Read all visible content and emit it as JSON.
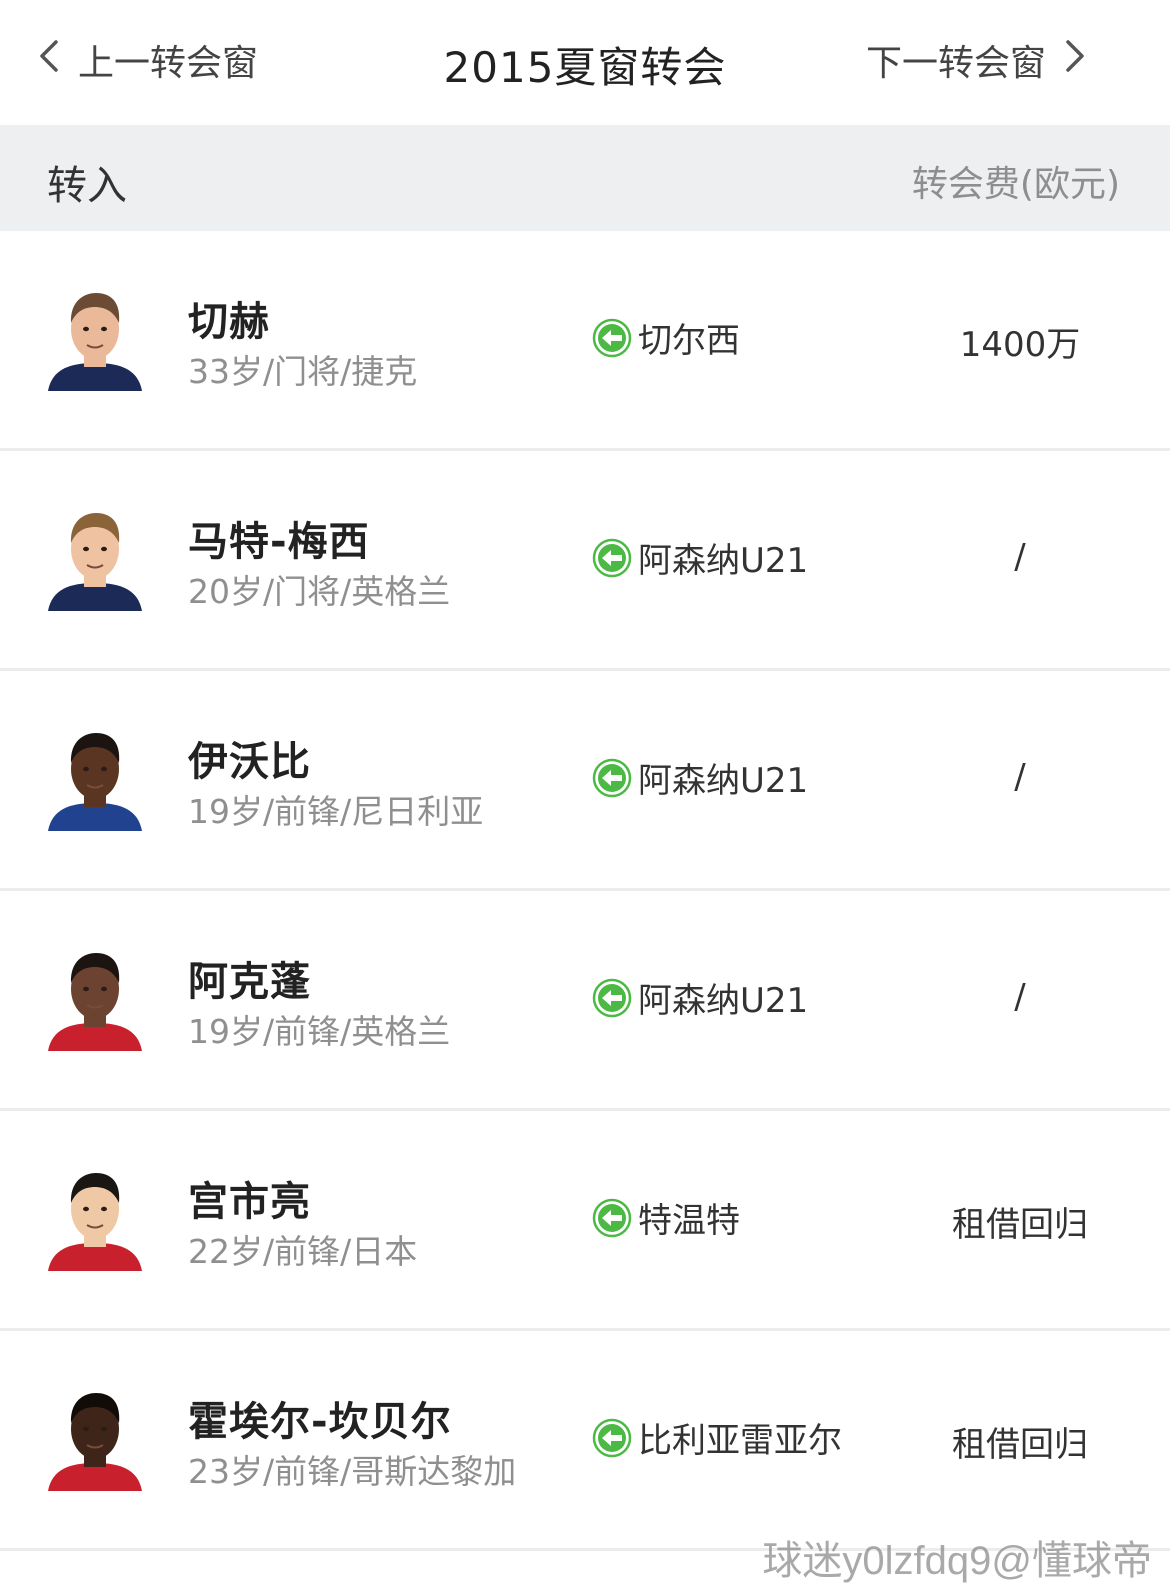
{
  "header": {
    "prev_label": "上一转会窗",
    "title": "2015夏窗转会",
    "next_label": "下一转会窗"
  },
  "section": {
    "title": "转入",
    "fee_header": "转会费(欧元)"
  },
  "colors": {
    "accent_green": "#4cb944",
    "header_bg": "#eeeff1"
  },
  "players": [
    {
      "name": "切赫",
      "meta": "33岁/门将/捷克",
      "from": "切尔西",
      "fee": "1400万",
      "skin": "#e9b99a",
      "hair": "#6b4b33",
      "kit": "#1b2a57"
    },
    {
      "name": "马特-梅西",
      "meta": "20岁/门将/英格兰",
      "from": "阿森纳U21",
      "fee": "/",
      "skin": "#efc2a2",
      "hair": "#8a6338",
      "kit": "#1b2a57"
    },
    {
      "name": "伊沃比",
      "meta": "19岁/前锋/尼日利亚",
      "from": "阿森纳U21",
      "fee": "/",
      "skin": "#5a3522",
      "hair": "#1c1410",
      "kit": "#21438f"
    },
    {
      "name": "阿克蓬",
      "meta": "19岁/前锋/英格兰",
      "from": "阿森纳U21",
      "fee": "/",
      "skin": "#6b4330",
      "hair": "#1b1411",
      "kit": "#c8212d"
    },
    {
      "name": "宫市亮",
      "meta": "22岁/前锋/日本",
      "from": "特温特",
      "fee": "租借回归",
      "skin": "#efc8a6",
      "hair": "#1a1614",
      "kit": "#c8212d"
    },
    {
      "name": "霍埃尔-坎贝尔",
      "meta": "23岁/前锋/哥斯达黎加",
      "from": "比利亚雷亚尔",
      "fee": "租借回归",
      "skin": "#3f2519",
      "hair": "#120c09",
      "kit": "#c8212d"
    }
  ],
  "watermark": "球迷y0lzfdq9@懂球帝"
}
